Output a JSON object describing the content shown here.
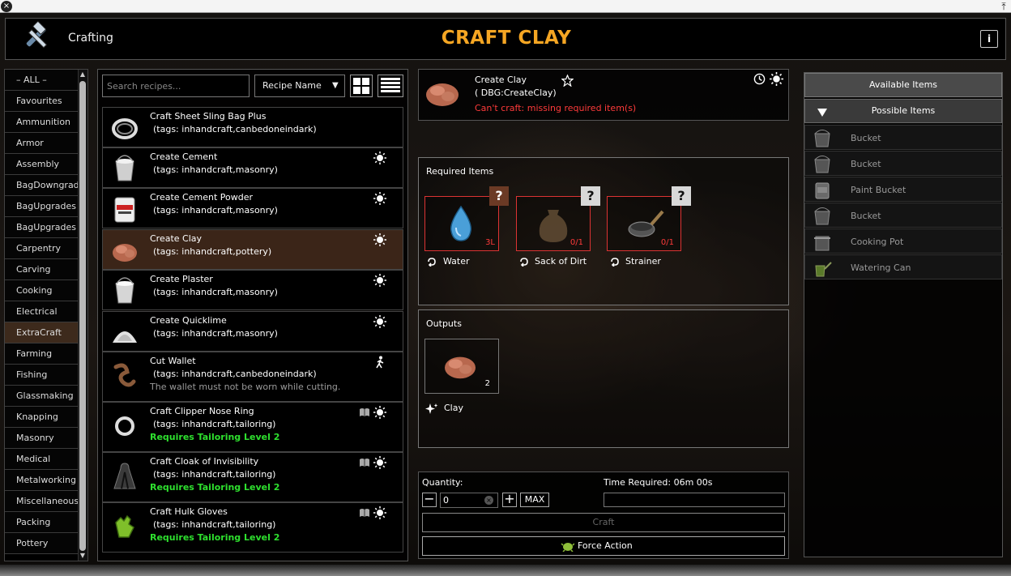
{
  "window": {
    "close": "×",
    "pin": "⤒"
  },
  "header": {
    "label": "Crafting",
    "title": "CRAFT CLAY",
    "info": "i"
  },
  "categories": [
    "– ALL –",
    "Favourites",
    "Ammunition",
    "Armor",
    "Assembly",
    "BagDowngrades",
    "BagUpgrades (",
    "BagUpgrades (",
    "Carpentry",
    "Carving",
    "Cooking",
    "Electrical",
    "ExtraCraft",
    "Farming",
    "Fishing",
    "Glassmaking",
    "Knapping",
    "Masonry",
    "Medical",
    "Metalworking",
    "Miscellaneous",
    "Packing",
    "Pottery"
  ],
  "selected_category": "ExtraCraft",
  "search": {
    "placeholder": "Search recipes..."
  },
  "sort": {
    "selected": "Recipe Name"
  },
  "recipes": [
    {
      "name": "Craft Sheet Sling Bag Plus",
      "tags": "(tags: inhandcraft,canbedoneindark)",
      "note": "",
      "icon": "sling-bag-icon",
      "badge": ""
    },
    {
      "name": "Create Cement",
      "tags": "(tags: inhandcraft,masonry)",
      "note": "",
      "icon": "bucket-cement-icon",
      "badge": "sun"
    },
    {
      "name": "Create Cement Powder",
      "tags": "(tags: inhandcraft,masonry)",
      "note": "",
      "icon": "cement-bag-icon",
      "badge": "sun"
    },
    {
      "name": "Create Clay",
      "tags": "(tags: inhandcraft,pottery)",
      "note": "",
      "icon": "clay-icon",
      "badge": "sun"
    },
    {
      "name": "Create Plaster",
      "tags": "(tags: inhandcraft,masonry)",
      "note": "",
      "icon": "bucket-plaster-icon",
      "badge": "sun"
    },
    {
      "name": "Create Quicklime",
      "tags": "(tags: inhandcraft,masonry)",
      "note": "",
      "icon": "quicklime-icon",
      "badge": "sun"
    },
    {
      "name": "Cut Wallet",
      "tags": "(tags: inhandcraft,canbedoneindark)",
      "note": "The wallet must not be worn while cutting.",
      "icon": "wallet-icon",
      "badge": "walk"
    },
    {
      "name": "Craft Clipper Nose Ring",
      "tags": "(tags: inhandcraft,tailoring)",
      "note": "Requires Tailoring Level 2",
      "icon": "nose-ring-icon",
      "badge": "book-sun"
    },
    {
      "name": "Craft Cloak of Invisibility",
      "tags": "(tags: inhandcraft,tailoring)",
      "note": "Requires Tailoring Level 2",
      "icon": "cloak-icon",
      "badge": "book-sun"
    },
    {
      "name": "Craft Hulk Gloves",
      "tags": "(tags: inhandcraft,tailoring)",
      "note": "Requires Tailoring Level 2",
      "icon": "gloves-icon",
      "badge": "book-sun"
    }
  ],
  "detail": {
    "name": "Create Clay",
    "debug": "( DBG:CreateClay)",
    "error": "Can't craft: missing required item(s)",
    "required_title": "Required Items",
    "required": [
      {
        "label": "Water",
        "count": "3L",
        "qmark": "?"
      },
      {
        "label": "Sack of Dirt",
        "count": "0/1",
        "qmark": "?"
      },
      {
        "label": "Strainer",
        "count": "0/1",
        "qmark": "?"
      }
    ],
    "outputs_title": "Outputs",
    "output": {
      "label": "Clay",
      "count": "2"
    }
  },
  "quantity": {
    "label": "Quantity:",
    "value": "0",
    "minus": "−",
    "plus": "+",
    "max": "MAX",
    "time_label": "Time Required: 06m 00s"
  },
  "buttons": {
    "craft": "Craft",
    "force": "Force Action"
  },
  "available": {
    "available_label": "Available Items",
    "possible_label": "Possible Items",
    "items": [
      "Bucket",
      "Bucket",
      "Paint Bucket",
      "Bucket",
      "Cooking Pot",
      "Watering Can"
    ]
  },
  "colors": {
    "title": "#f5a623",
    "error": "#ff3a3a",
    "requirement": "#2ee02e",
    "selected_row": "#3b2518"
  }
}
